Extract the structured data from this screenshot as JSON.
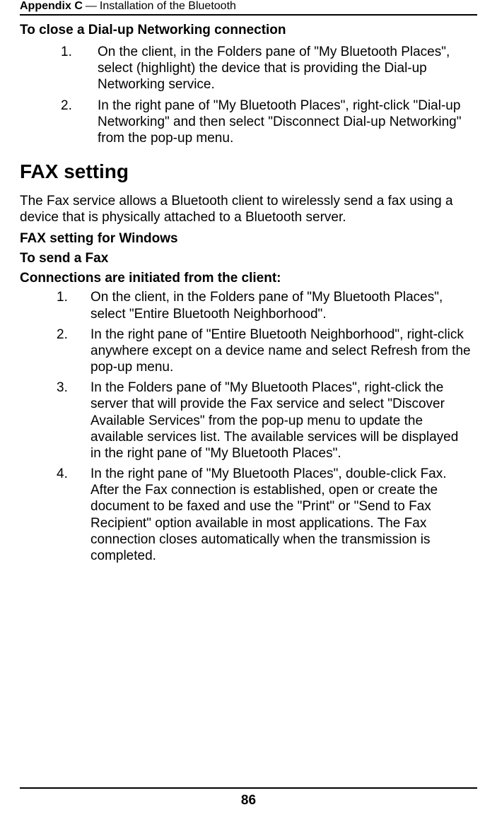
{
  "header": {
    "appendix": "Appendix C",
    "separator": " — ",
    "title": "Installation of the Bluetooth"
  },
  "section1": {
    "title": "To close a Dial-up Networking connection",
    "items": [
      {
        "num": "1.",
        "text": "On the client, in the Folders pane of \"My Bluetooth Places\", select (highlight) the device that is providing the Dial-up Networking service."
      },
      {
        "num": "2.",
        "text": "In the right pane of \"My Bluetooth Places\", right-click \"Dial-up Networking\" and then select \"Disconnect Dial-up Networking\" from the pop-up menu."
      }
    ]
  },
  "heading2": "FAX setting",
  "intro": "The Fax service allows a Bluetooth client to wirelessly send a fax using a device that is physically attached to a Bluetooth server.",
  "bold_lines": {
    "l1": "FAX setting for Windows",
    "l2": "To send a Fax",
    "l3": "Connections are initiated from the client:"
  },
  "section2": {
    "items": [
      {
        "num": "1.",
        "text": "On the client, in the Folders pane of \"My Bluetooth Places\", select \"Entire Bluetooth Neighborhood\"."
      },
      {
        "num": "2.",
        "text": "In the right pane of \"Entire Bluetooth Neighborhood\", right-click anywhere except on a device name and select Refresh from the pop-up menu."
      },
      {
        "num": "3.",
        "text": "In the Folders pane of \"My Bluetooth Places\", right-click the server that will provide the Fax service and select \"Discover Available Services\" from the pop-up menu to update the available services list. The available services will be displayed in the right pane of \"My Bluetooth Places\"."
      },
      {
        "num": "4.",
        "text": "In the right pane of \"My Bluetooth Places\", double-click Fax. After the Fax connection is established, open or create the document to be faxed and use the \"Print\" or \"Send to Fax Recipient\" option available in most applications. The Fax connection closes automatically when the transmission is completed."
      }
    ]
  },
  "footer": {
    "page_number": "86"
  }
}
